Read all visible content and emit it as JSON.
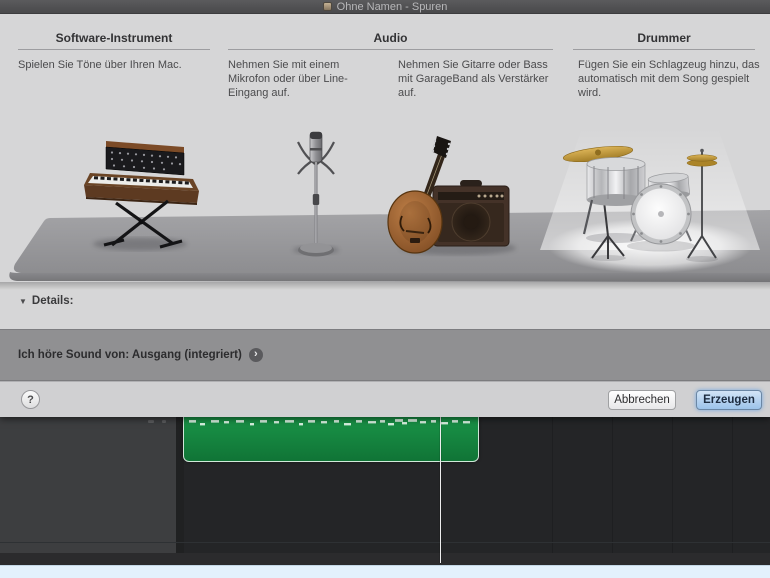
{
  "window": {
    "title": "Ohne Namen - Spuren"
  },
  "dialog": {
    "headers": {
      "software": "Software-Instrument",
      "audio": "Audio",
      "drummer": "Drummer"
    },
    "descriptions": {
      "software": "Spielen Sie Töne über Ihren Mac.",
      "microphone": "Nehmen Sie mit einem Mikrofon oder über Line-Eingang auf.",
      "guitar": "Nehmen Sie Gitarre oder Bass mit GarageBand als Verstärker auf.",
      "drummer": "Fügen Sie ein Schlagzeug hinzu, das automatisch mit dem Song gespielt wird."
    },
    "selected_option": "drummer",
    "details": {
      "label": "Details:",
      "disclosure_icon": "▼"
    },
    "sound_row": {
      "text": "Ich höre Sound von: Ausgang (integriert)",
      "chevron_icon": "›"
    },
    "footer": {
      "help": "?",
      "cancel": "Abbrechen",
      "create": "Erzeugen"
    }
  },
  "colors": {
    "create_button_blue": "#9cc3ea",
    "region_green": "#178a3f",
    "selection_glow": "#ffffff",
    "bottom_strip_blue": "#e3f1fc",
    "titlebar_gray": "#4f4f51"
  }
}
